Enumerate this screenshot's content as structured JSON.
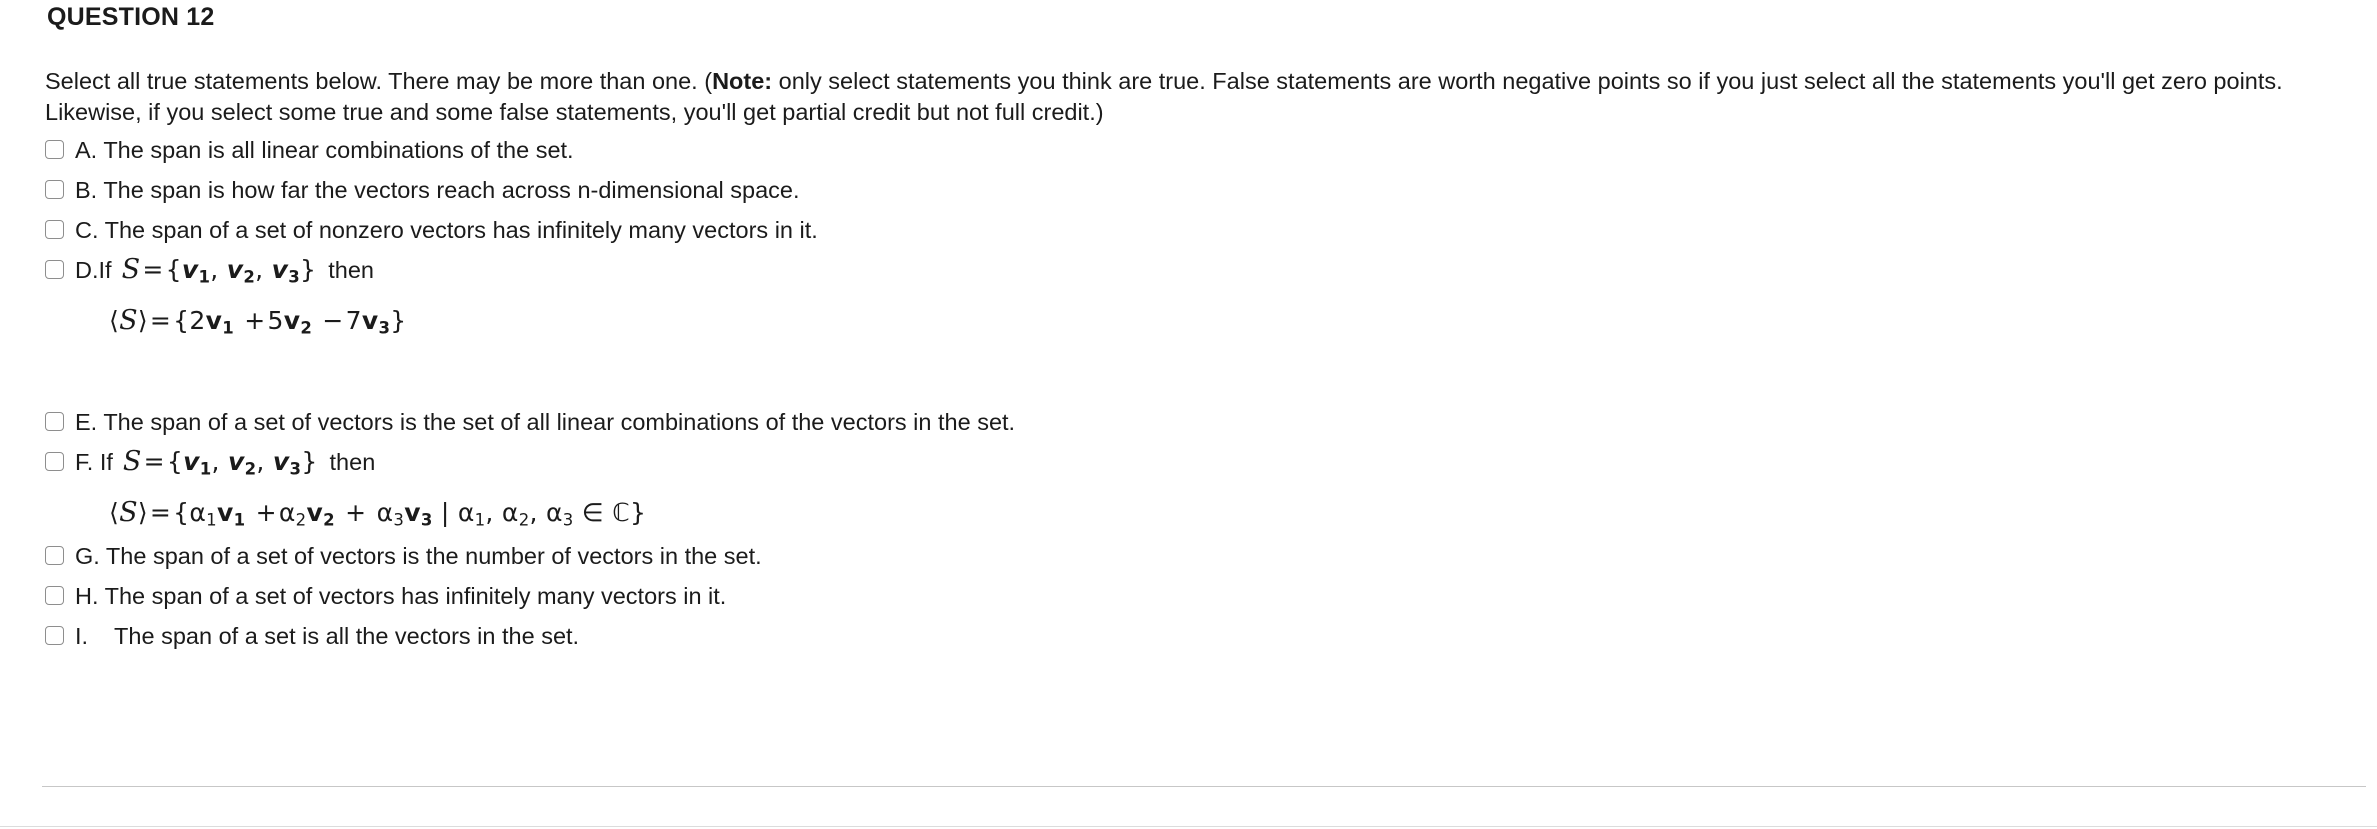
{
  "heading": "QUESTION 12",
  "instructions": {
    "part1": "Select all true statements below.  There may be more than one.  (",
    "note_label": "Note:",
    "part2": " only select statements you think are true. False statements are worth negative points so if you just select all the statements you'll get zero points. Likewise, if you select some true and some false statements, you'll get partial credit but not full credit.)"
  },
  "options": [
    {
      "label": "A.",
      "text": "The span is all linear combinations of the set."
    },
    {
      "label": "B.",
      "text": "The span is how far the vectors reach across n-dimensional space."
    },
    {
      "label": "C.",
      "text": "The span of a set of nonzero vectors has infinitely many vectors in it."
    },
    {
      "label": "D.",
      "text": "",
      "if_word": "If",
      "then_word": "then",
      "set_def": "S = {v1, v2, v3}",
      "formula": "⟨S⟩ = {2v1 + 5v2 − 7v3}"
    },
    {
      "label": "E.",
      "text": "The span of a set of vectors is the set of all linear combinations of the vectors in the set."
    },
    {
      "label": "F.",
      "text": "",
      "if_word": "If",
      "then_word": "then",
      "set_def": "S = {v1, v2, v3}",
      "formula": "⟨S⟩ = {α1v1 + α2v2 + α3v3 | α1, α2, α3 ∈ ℂ}"
    },
    {
      "label": "G.",
      "text": "The span of a set of vectors is the number of vectors in the set."
    },
    {
      "label": "H.",
      "text": "The span of a set of vectors has infinitely many vectors in it."
    },
    {
      "label": "I.",
      "text": " The span of a set is all the vectors in the set."
    }
  ],
  "math_symbols": {
    "S": "S",
    "equals": "=",
    "lbrace": "{",
    "rbrace": "}",
    "comma": ",",
    "v": "v",
    "sub1": "1",
    "sub2": "2",
    "sub3": "3",
    "angle_open": "⟨",
    "angle_close": "⟩",
    "plus": "+",
    "minus": "−",
    "two": "2",
    "five": "5",
    "seven": "7",
    "alpha": "α",
    "mid": "|",
    "in": "∈",
    "complex": "ℂ"
  },
  "colors": {
    "text": "#1b1b1b",
    "checkbox_border": "#8e8e8e",
    "divider": "#c7c7c7",
    "background": "#ffffff"
  }
}
